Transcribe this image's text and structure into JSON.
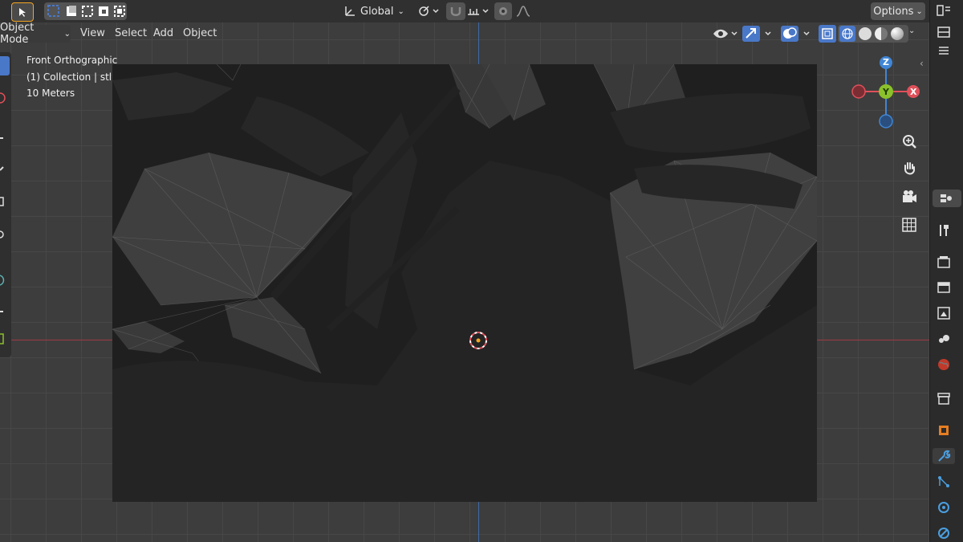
{
  "header": {
    "transform_orientation": "Global",
    "options_label": "Options"
  },
  "menubar": {
    "mode": "Object Mode",
    "items": [
      "View",
      "Select",
      "Add",
      "Object"
    ]
  },
  "overlay": {
    "view_name": "Front Orthographic",
    "collection": "(1) Collection | stl",
    "scale": "10 Meters"
  },
  "gizmo": {
    "z": "Z",
    "y": "Y",
    "x": "X"
  },
  "colors": {
    "x_axis": "#e0505a",
    "y_axis": "#8bc12b",
    "z_axis": "#3f86d6",
    "accent": "#4a78c8",
    "origin": "#f5a623"
  },
  "icons": [
    "select-box-icon",
    "global-transform-icon",
    "snap-icon",
    "proportional-icon",
    "visibility-icon",
    "gizmo-icon",
    "overlay-icon",
    "xray-icon",
    "wireframe-shading-icon",
    "solid-shading-icon",
    "material-shading-icon",
    "rendered-shading-icon",
    "zoom-icon",
    "pan-icon",
    "camera-icon",
    "ortho-grid-icon",
    "tool-icon",
    "render-props-icon",
    "output-props-icon",
    "view-layer-icon",
    "scene-icon",
    "world-icon",
    "collection-icon",
    "object-icon",
    "modifier-icon",
    "particles-icon",
    "physics-icon",
    "constraints-icon"
  ]
}
